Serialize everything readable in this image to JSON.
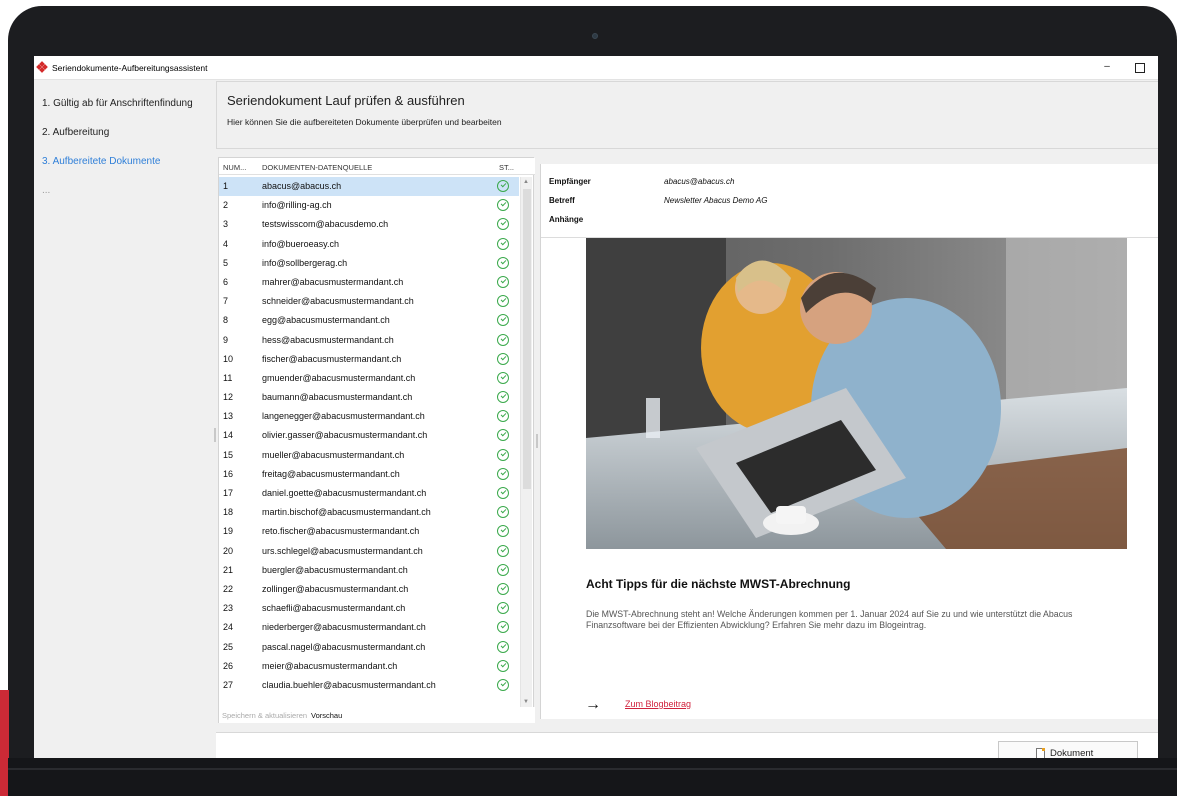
{
  "window": {
    "title": "Seriendokumente-Aufbereitungsassistent",
    "minimize": "–"
  },
  "wizard": {
    "steps": [
      {
        "label": "1. Gültig ab für Anschriftenfindung"
      },
      {
        "label": "2. Aufbereitung"
      },
      {
        "label": "3. Aufbereitete Dokumente"
      },
      {
        "label": "..."
      }
    ],
    "active_step": 3
  },
  "header": {
    "title": "Seriendokument Lauf prüfen & ausführen",
    "subtitle": "Hier können Sie die aufbereiteten Dokumente überprüfen und bearbeiten"
  },
  "list": {
    "columns": [
      "NUM...",
      "DOKUMENTEN-DATENQUELLE",
      "ST..."
    ],
    "rows": [
      {
        "num": "1",
        "source": "abacus@abacus.ch"
      },
      {
        "num": "2",
        "source": "info@rilling-ag.ch"
      },
      {
        "num": "3",
        "source": "testswisscom@abacusdemo.ch"
      },
      {
        "num": "4",
        "source": "info@bueroeasy.ch"
      },
      {
        "num": "5",
        "source": "info@sollbergerag.ch"
      },
      {
        "num": "6",
        "source": "mahrer@abacusmustermandant.ch"
      },
      {
        "num": "7",
        "source": "schneider@abacusmustermandant.ch"
      },
      {
        "num": "8",
        "source": "egg@abacusmustermandant.ch"
      },
      {
        "num": "9",
        "source": "hess@abacusmustermandant.ch"
      },
      {
        "num": "10",
        "source": "fischer@abacusmustermandant.ch"
      },
      {
        "num": "11",
        "source": "gmuender@abacusmustermandant.ch"
      },
      {
        "num": "12",
        "source": "baumann@abacusmustermandant.ch"
      },
      {
        "num": "13",
        "source": "langenegger@abacusmustermandant.ch"
      },
      {
        "num": "14",
        "source": "olivier.gasser@abacusmustermandant.ch"
      },
      {
        "num": "15",
        "source": "mueller@abacusmustermandant.ch"
      },
      {
        "num": "16",
        "source": "freitag@abacusmustermandant.ch"
      },
      {
        "num": "17",
        "source": "daniel.goette@abacusmustermandant.ch"
      },
      {
        "num": "18",
        "source": "martin.bischof@abacusmustermandant.ch"
      },
      {
        "num": "19",
        "source": "reto.fischer@abacusmustermandant.ch"
      },
      {
        "num": "20",
        "source": "urs.schlegel@abacusmustermandant.ch"
      },
      {
        "num": "21",
        "source": "buergler@abacusmustermandant.ch"
      },
      {
        "num": "22",
        "source": "zollinger@abacusmustermandant.ch"
      },
      {
        "num": "23",
        "source": "schaefli@abacusmustermandant.ch"
      },
      {
        "num": "24",
        "source": "niederberger@abacusmustermandant.ch"
      },
      {
        "num": "25",
        "source": "pascal.nagel@abacusmustermandant.ch"
      },
      {
        "num": "26",
        "source": "meier@abacusmustermandant.ch"
      },
      {
        "num": "27",
        "source": "claudia.buehler@abacusmustermandant.ch"
      }
    ],
    "selected_row": 1,
    "status_icon": "check-circle-icon",
    "tabs": [
      "Speichern & aktualisieren",
      "Vorschau"
    ],
    "active_tab": "Vorschau"
  },
  "preview": {
    "recipient_label": "Empfänger",
    "recipient_value": "abacus@abacus.ch",
    "subject_label": "Betreff",
    "subject_value": "Newsletter Abacus Demo AG",
    "attachments_label": "Anhänge",
    "article_title": "Acht Tipps für die nächste MWST-Abrechnung",
    "article_body": "Die MWST-Abrechnung steht an! Welche Änderungen kommen per 1. Januar 2024 auf Sie zu und wie unterstützt die Abacus Finanzsoftware bei der Effizienten Abwicklung? Erfahren Sie mehr dazu im Blogeintrag.",
    "arrow": "→",
    "link_text": "Zum Blogbeitrag"
  },
  "footer": {
    "edit_button": "Dokument bearbeiten"
  },
  "colors": {
    "accent": "#2f7fd8",
    "selection": "#cde3f7",
    "status_ok": "#3aa94b",
    "link": "#d0213c",
    "brand_red": "#cc2a36"
  }
}
